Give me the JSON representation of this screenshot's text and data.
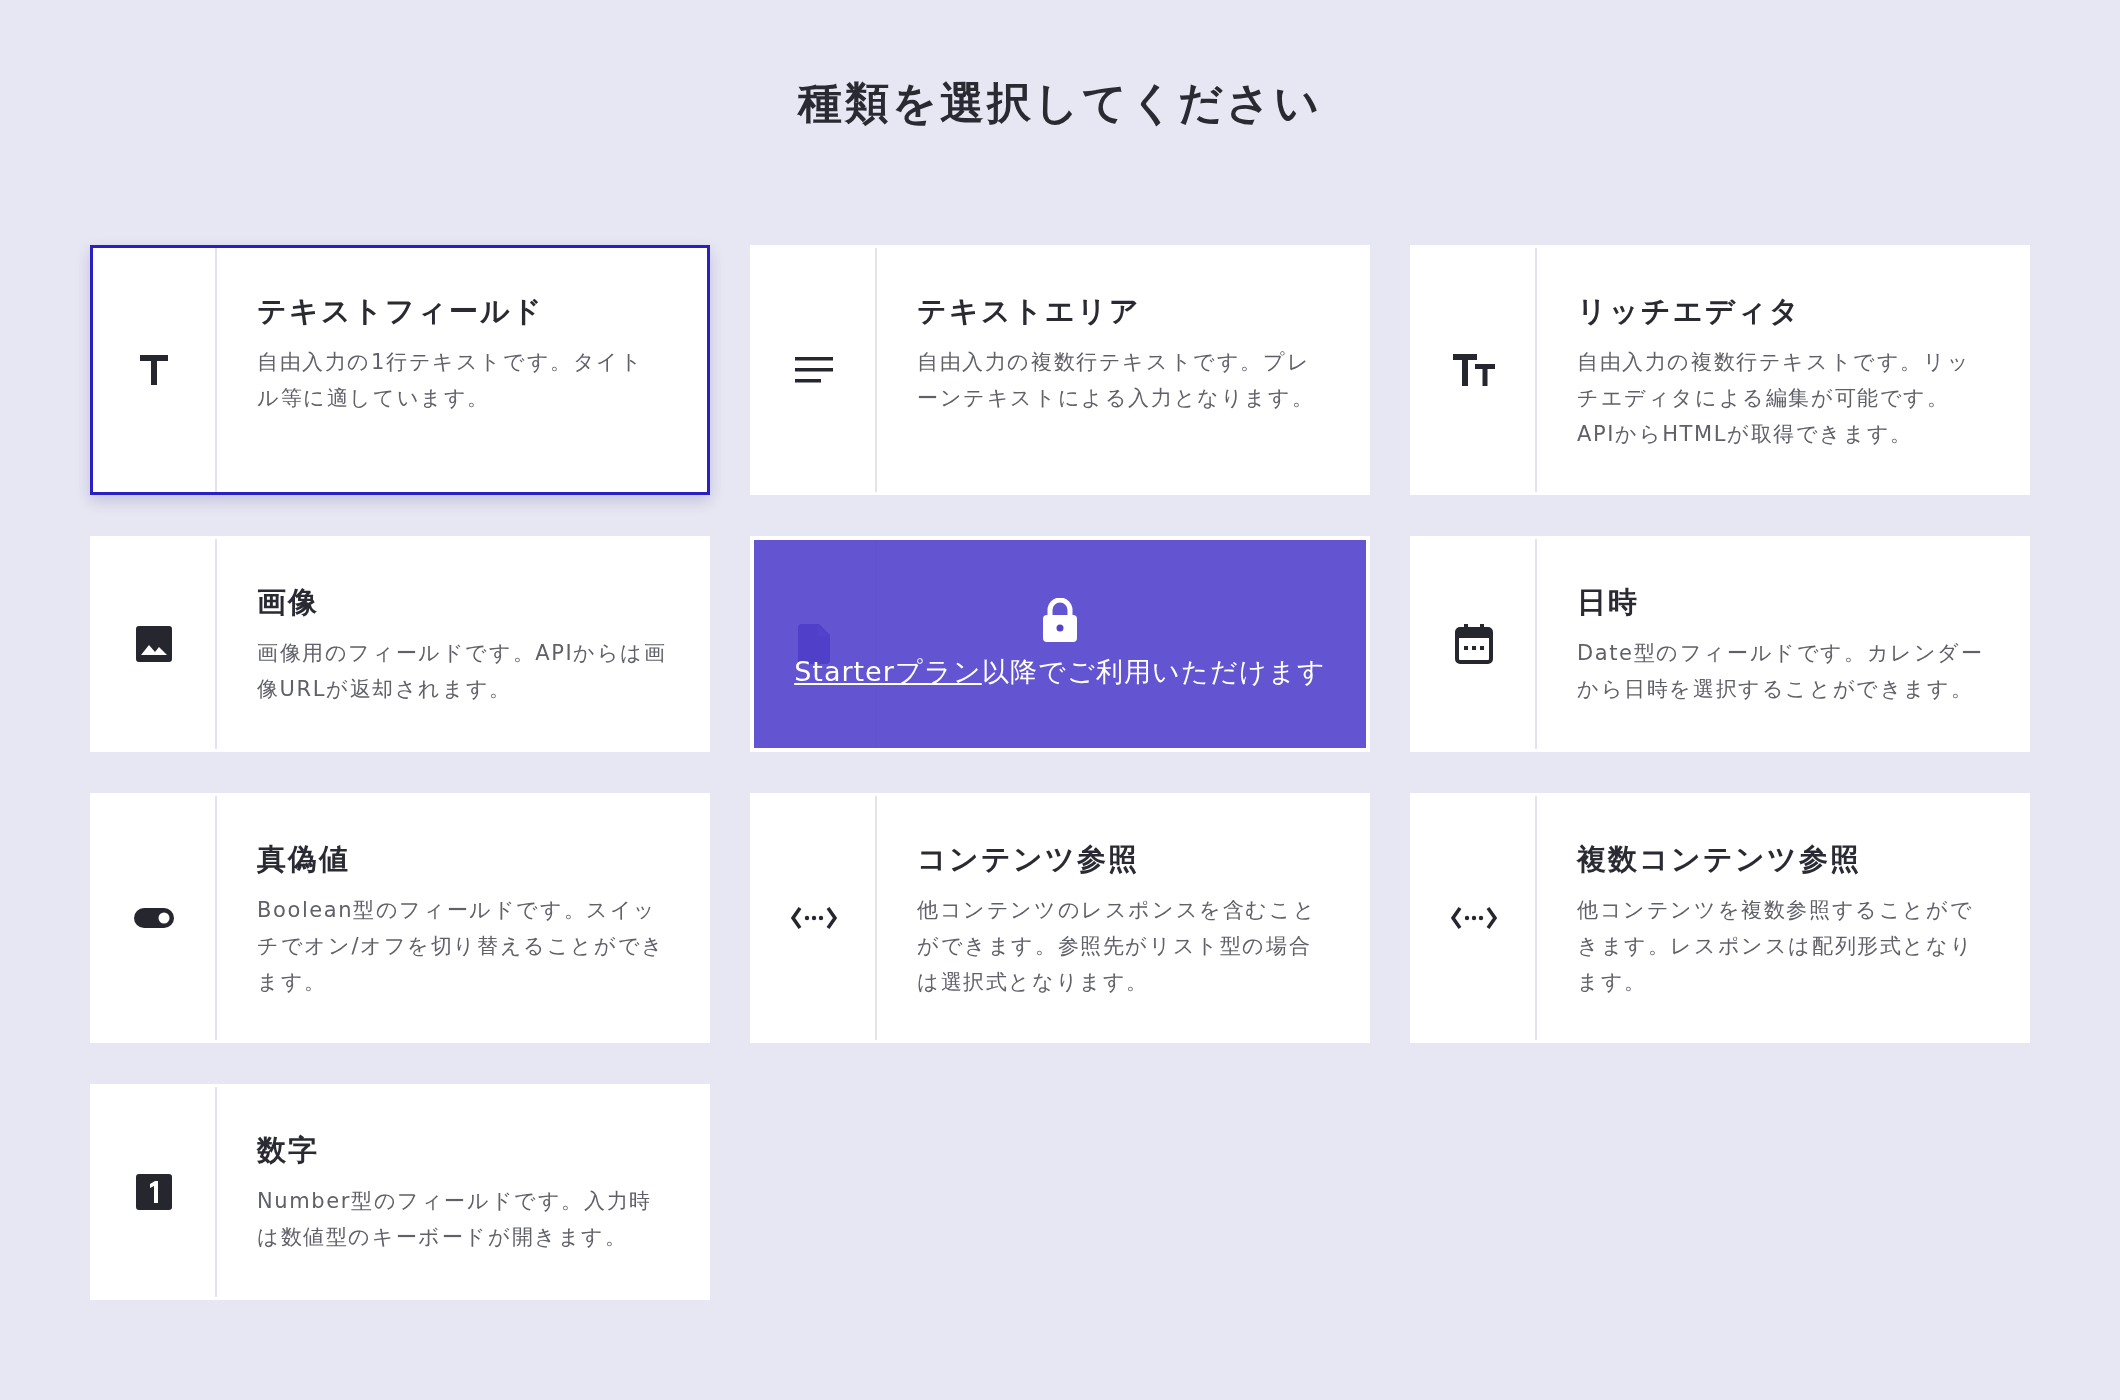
{
  "heading": "種類を選択してください",
  "cards": [
    {
      "kind": "text",
      "title": "テキストフィールド",
      "description": "自由入力の1行テキストです。タイトル等に適しています。",
      "selected": true,
      "locked": false
    },
    {
      "kind": "textarea",
      "title": "テキストエリア",
      "description": "自由入力の複数行テキストです。プレーンテキストによる入力となります。",
      "selected": false,
      "locked": false
    },
    {
      "kind": "rich",
      "title": "リッチエディタ",
      "description": "自由入力の複数行テキストです。リッチエディタによる編集が可能です。APIからHTMLが取得できます。",
      "selected": false,
      "locked": false
    },
    {
      "kind": "image",
      "title": "画像",
      "description": "画像用のフィールドです。APIからは画像URLが返却されます。",
      "selected": false,
      "locked": false
    },
    {
      "kind": "file",
      "selected": false,
      "locked": true,
      "lock_link": "Starterプラン",
      "lock_text": "以降でご利用いただけます"
    },
    {
      "kind": "calendar",
      "title": "日時",
      "description": "Date型のフィールドです。カレンダーから日時を選択することができます。",
      "selected": false,
      "locked": false
    },
    {
      "kind": "toggle",
      "title": "真偽値",
      "description": "Boolean型のフィールドです。スイッチでオン/オフを切り替えることができます。",
      "selected": false,
      "locked": false
    },
    {
      "kind": "reference",
      "title": "コンテンツ参照",
      "description": "他コンテンツのレスポンスを含むことができます。参照先がリスト型の場合は選択式となります。",
      "selected": false,
      "locked": false
    },
    {
      "kind": "reference",
      "title": "複数コンテンツ参照",
      "description": "他コンテンツを複数参照することができます。レスポンスは配列形式となります。",
      "selected": false,
      "locked": false
    },
    {
      "kind": "number",
      "title": "数字",
      "description": "Number型のフィールドです。入力時は数値型のキーボードが開きます。",
      "selected": false,
      "locked": false
    }
  ]
}
